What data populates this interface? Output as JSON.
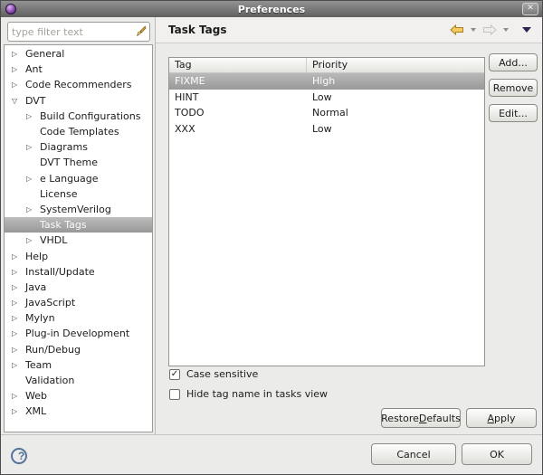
{
  "titlebar": {
    "title": "Preferences"
  },
  "icons": {
    "close": "✕",
    "tree_collapsed": "▷",
    "tree_expanded": "▽",
    "checkmark": "✓",
    "help": "?"
  },
  "sidebar": {
    "filter_placeholder": "type filter text",
    "tree": [
      {
        "label": "General",
        "level": 0,
        "arrow": "right"
      },
      {
        "label": "Ant",
        "level": 0,
        "arrow": "right"
      },
      {
        "label": "Code Recommenders",
        "level": 0,
        "arrow": "right"
      },
      {
        "label": "DVT",
        "level": 0,
        "arrow": "down"
      },
      {
        "label": "Build Configurations",
        "level": 1,
        "arrow": "right"
      },
      {
        "label": "Code Templates",
        "level": 1,
        "arrow": "none"
      },
      {
        "label": "Diagrams",
        "level": 1,
        "arrow": "right"
      },
      {
        "label": "DVT Theme",
        "level": 1,
        "arrow": "none"
      },
      {
        "label": "e Language",
        "level": 1,
        "arrow": "right"
      },
      {
        "label": "License",
        "level": 1,
        "arrow": "none"
      },
      {
        "label": "SystemVerilog",
        "level": 1,
        "arrow": "right"
      },
      {
        "label": "Task Tags",
        "level": 1,
        "arrow": "none",
        "selected": true
      },
      {
        "label": "VHDL",
        "level": 1,
        "arrow": "right"
      },
      {
        "label": "Help",
        "level": 0,
        "arrow": "right"
      },
      {
        "label": "Install/Update",
        "level": 0,
        "arrow": "right"
      },
      {
        "label": "Java",
        "level": 0,
        "arrow": "right"
      },
      {
        "label": "JavaScript",
        "level": 0,
        "arrow": "right"
      },
      {
        "label": "Mylyn",
        "level": 0,
        "arrow": "right"
      },
      {
        "label": "Plug-in Development",
        "level": 0,
        "arrow": "right"
      },
      {
        "label": "Run/Debug",
        "level": 0,
        "arrow": "right"
      },
      {
        "label": "Team",
        "level": 0,
        "arrow": "right"
      },
      {
        "label": "Validation",
        "level": 0,
        "arrow": "none"
      },
      {
        "label": "Web",
        "level": 0,
        "arrow": "right"
      },
      {
        "label": "XML",
        "level": 0,
        "arrow": "right"
      }
    ]
  },
  "header": {
    "title": "Task Tags"
  },
  "task_table": {
    "columns": [
      "Tag",
      "Priority"
    ],
    "rows": [
      {
        "tag": "FIXME",
        "priority": "High",
        "selected": true
      },
      {
        "tag": "HINT",
        "priority": "Low",
        "selected": false
      },
      {
        "tag": "TODO",
        "priority": "Normal",
        "selected": false
      },
      {
        "tag": "XXX",
        "priority": "Low",
        "selected": false
      }
    ]
  },
  "side_buttons": {
    "add": "Add...",
    "remove": "Remove",
    "edit": "Edit..."
  },
  "options": [
    {
      "label": "Case sensitive",
      "checked": true
    },
    {
      "label": "Hide tag name in tasks view",
      "checked": false
    }
  ],
  "panel_buttons": {
    "restore": {
      "label": "Restore Defaults",
      "mnemonic_index": 8
    },
    "apply": {
      "label": "Apply",
      "mnemonic_index": 0
    }
  },
  "dialog_buttons": {
    "cancel": "Cancel",
    "ok": "OK"
  },
  "colors": {
    "selection_gray_top": "#b9b9b9",
    "selection_gray_bottom": "#999999",
    "back_arrow_gold": "#f3cb62",
    "view_menu_purple": "#2c2255",
    "help_blue": "#54729b"
  }
}
